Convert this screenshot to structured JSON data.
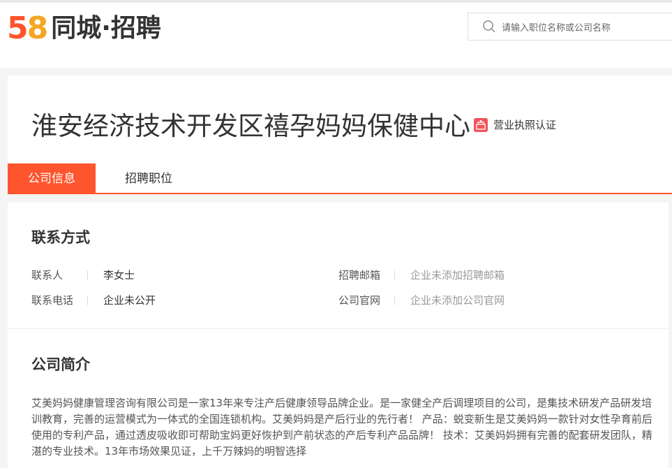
{
  "header": {
    "logo": {
      "digit1": "5",
      "digit2": "8",
      "text": "同城·招聘"
    },
    "search": {
      "placeholder": "请输入职位名称或公司名称"
    }
  },
  "company": {
    "name": "淮安经济技术开发区禧孕妈妈保健中心",
    "license_label": "营业执照认证"
  },
  "tabs": [
    {
      "label": "公司信息",
      "active": true
    },
    {
      "label": "招聘职位",
      "active": false
    }
  ],
  "contact": {
    "title": "联系方式",
    "fields": [
      {
        "label": "联系人",
        "value": "李女士"
      },
      {
        "label": "招聘邮箱",
        "value": "企业未添加招聘邮箱"
      },
      {
        "label": "联系电话",
        "value": "企业未公开"
      },
      {
        "label": "公司官网",
        "value": "企业未添加公司官网"
      }
    ]
  },
  "intro": {
    "title": "公司简介",
    "text": "艾美妈妈健康管理咨询有限公司是一家13年来专注产后健康领导品牌企业。是一家健全产后调理项目的公司，是集技术研发产品研发培训教育，完善的运营模式为一体式的全国连锁机构。艾美妈妈是产后行业的先行者！ 产品：蜕变新生是艾美妈妈一款针对女性孕育前后使用的专利产品，通过透皮吸收即可帮助宝妈更好恢护到产前状态的产后专利产品品牌！ 技术：艾美妈妈拥有完善的配套研发团队，精湛的专业技术。13年市场效果见证，上千万辣妈的明智选择"
  },
  "colors": {
    "accent": "#ff552e",
    "logo_orange": "#f5a623",
    "license_red": "#f4555a"
  }
}
